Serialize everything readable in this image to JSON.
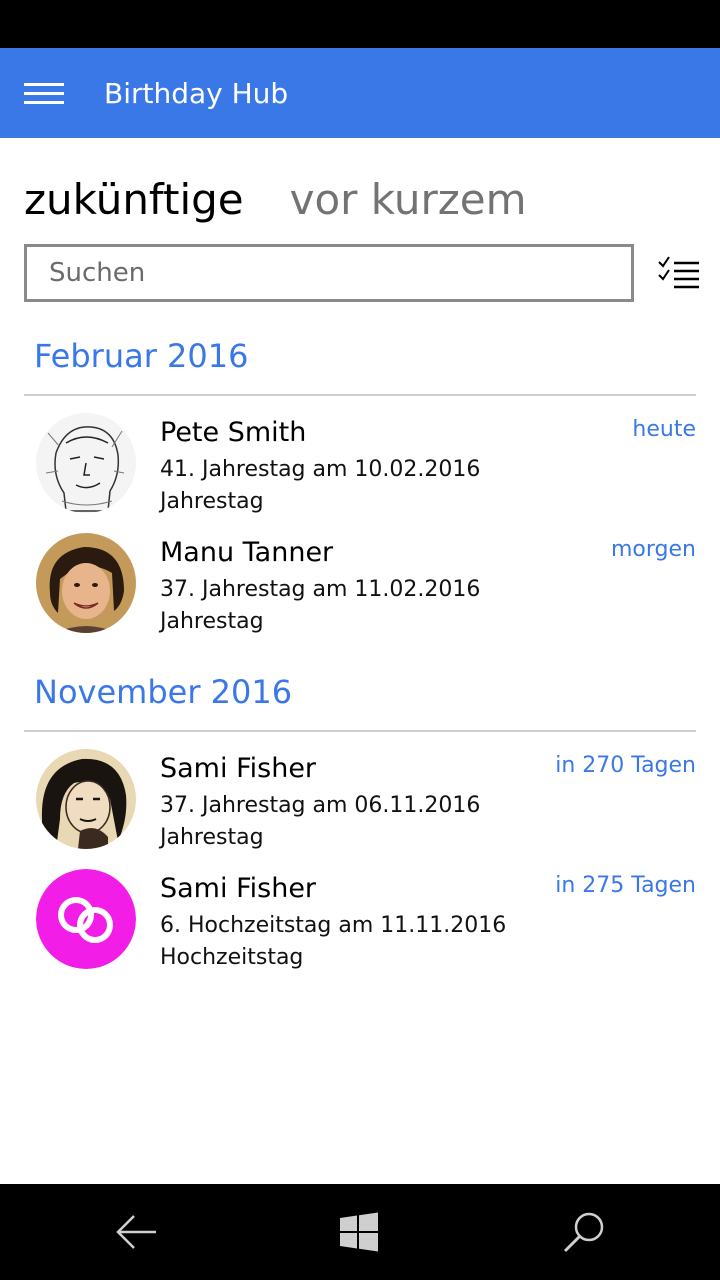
{
  "header": {
    "title": "Birthday Hub",
    "menu_icon": "hamburger-icon"
  },
  "pivot": {
    "tabs": [
      {
        "label": "zukünftige"
      },
      {
        "label": "vor kurzem"
      }
    ]
  },
  "search": {
    "placeholder": "Suchen",
    "select_icon": "multi-select-icon"
  },
  "colors": {
    "accent": "#3a78e8",
    "avatar_magenta": "#f21ee8"
  },
  "groups": [
    {
      "header": "Februar 2016",
      "items": [
        {
          "name": "Pete Smith",
          "detail": "41. Jahrestag am 10.02.2016",
          "type": "Jahrestag",
          "when": "heute"
        },
        {
          "name": "Manu Tanner",
          "detail": "37. Jahrestag am 11.02.2016",
          "type": "Jahrestag",
          "when": "morgen"
        }
      ]
    },
    {
      "header": "November 2016",
      "items": [
        {
          "name": "Sami Fisher",
          "detail": "37. Jahrestag am 06.11.2016",
          "type": "Jahrestag",
          "when": "in 270 Tagen"
        },
        {
          "name": "Sami Fisher",
          "detail": "6. Hochzeitstag am 11.11.2016",
          "type": "Hochzeitstag",
          "when": "in 275 Tagen"
        }
      ]
    }
  ],
  "nav": {
    "icons": [
      "back-icon",
      "windows-icon",
      "search-icon"
    ]
  }
}
